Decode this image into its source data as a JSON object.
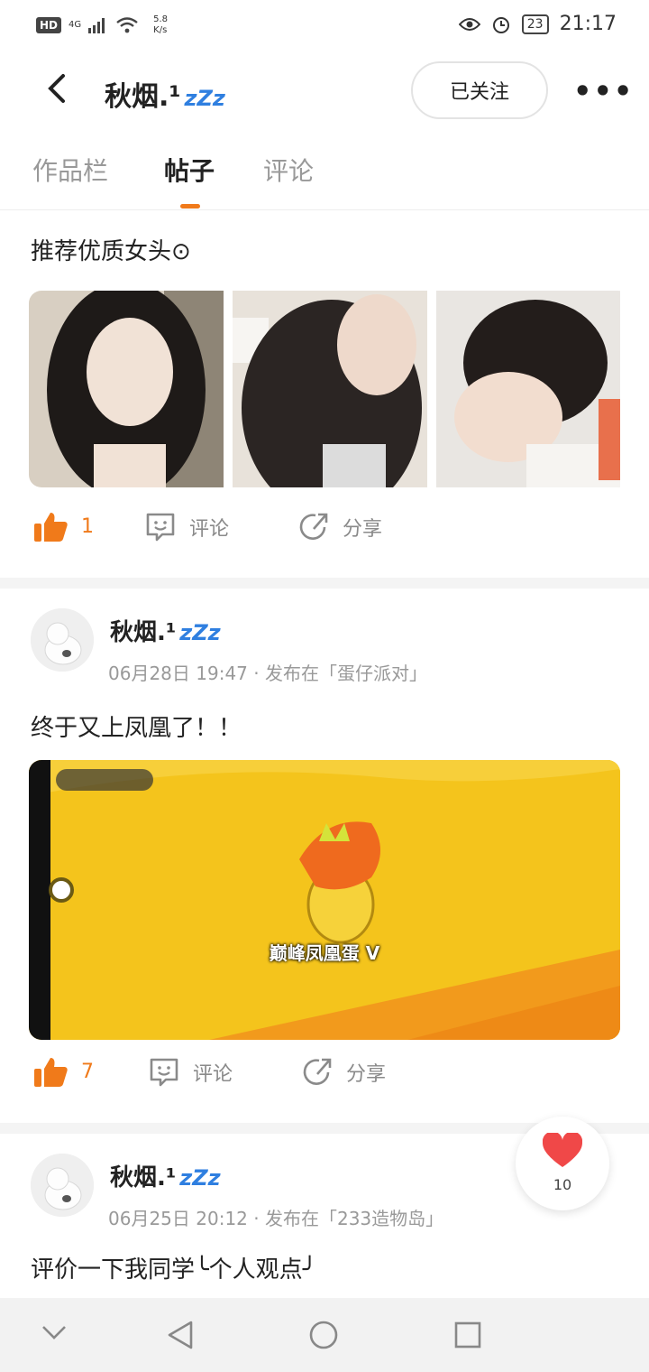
{
  "status_bar": {
    "hd": "HD",
    "network": "4G",
    "speed_value": "5.8",
    "speed_unit": "K/s",
    "battery": "23",
    "time": "21:17"
  },
  "header": {
    "username": "秋烟.¹",
    "sleep_badge": "zZz",
    "follow_label": "已关注",
    "more_label": "•••"
  },
  "tabs": [
    {
      "label": "作品栏"
    },
    {
      "label": "帖子"
    },
    {
      "label": "评论"
    }
  ],
  "posts": [
    {
      "text": "推荐优质女头⊙",
      "images": [
        "photo-1",
        "photo-2",
        "photo-3"
      ],
      "likes": "1",
      "comment_label": "评论",
      "share_label": "分享"
    },
    {
      "author": "秋烟.¹",
      "badge": "zZz",
      "date": "06月28日 19:47",
      "published_in": "· 发布在「蛋仔派对」",
      "text": "终于又上凤凰了！！",
      "game_text": "巅峰凤凰蛋 V",
      "likes": "7",
      "comment_label": "评论",
      "share_label": "分享"
    },
    {
      "author": "秋烟.¹",
      "badge": "zZz",
      "date": "06月25日  20:12",
      "published_in": "· 发布在「233造物岛」",
      "text": "评价一下我同学╰个人观点╯"
    }
  ],
  "floating_like": {
    "count": "10"
  },
  "colors": {
    "accent": "#f07a1a",
    "badge": "#2f7fe0",
    "heart": "#f04848"
  }
}
